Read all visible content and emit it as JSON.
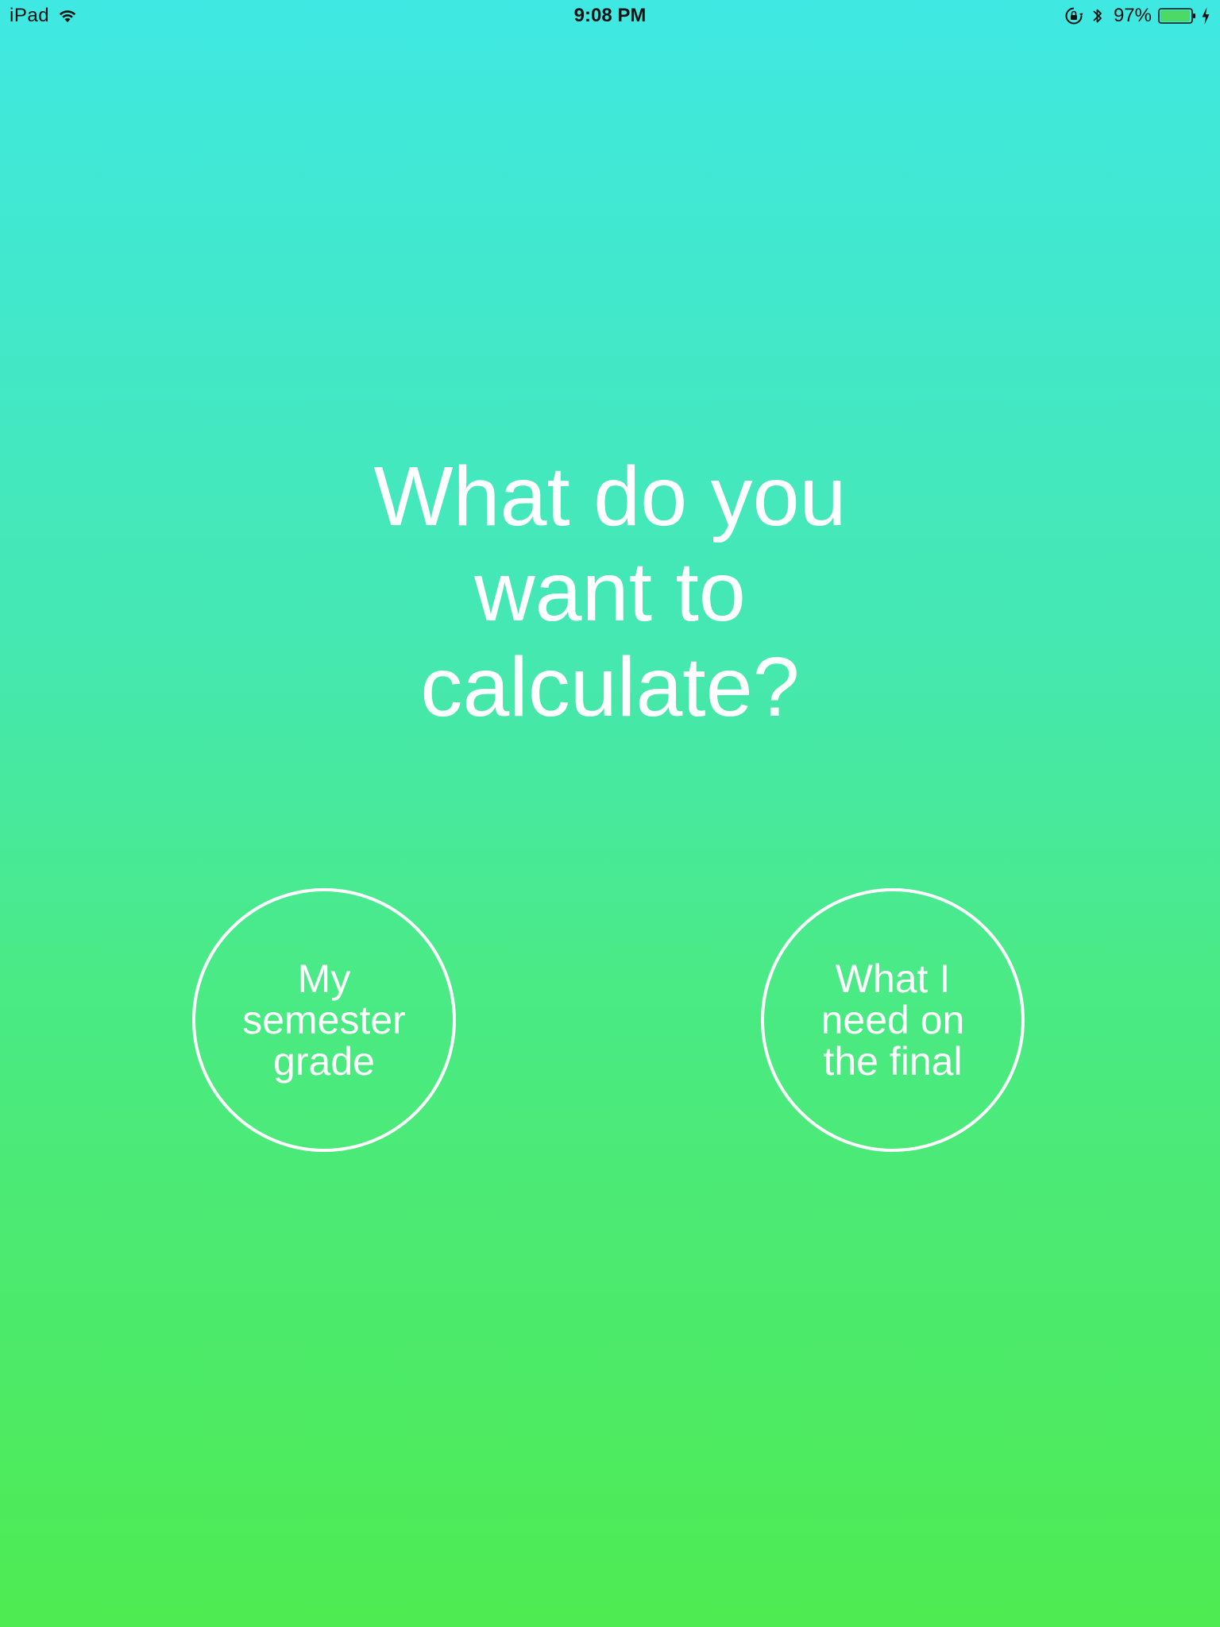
{
  "status_bar": {
    "device": "iPad",
    "time": "9:08 PM",
    "battery_percent": "97%",
    "battery_level": 0.97,
    "battery_color": "#4cd964",
    "icons": [
      "wifi-icon",
      "orientation-lock-icon",
      "bluetooth-icon",
      "battery-icon",
      "charging-bolt-icon"
    ]
  },
  "main": {
    "title_lines": [
      "What do you",
      "want to",
      "calculate?"
    ],
    "options": [
      {
        "label_lines": [
          "My",
          "semester",
          "grade"
        ]
      },
      {
        "label_lines": [
          "What I",
          "need on",
          "the final"
        ]
      }
    ]
  },
  "colors": {
    "gradient_top": "#3fe8e2",
    "gradient_bottom": "#4eeb52",
    "foreground": "#ffffff"
  }
}
